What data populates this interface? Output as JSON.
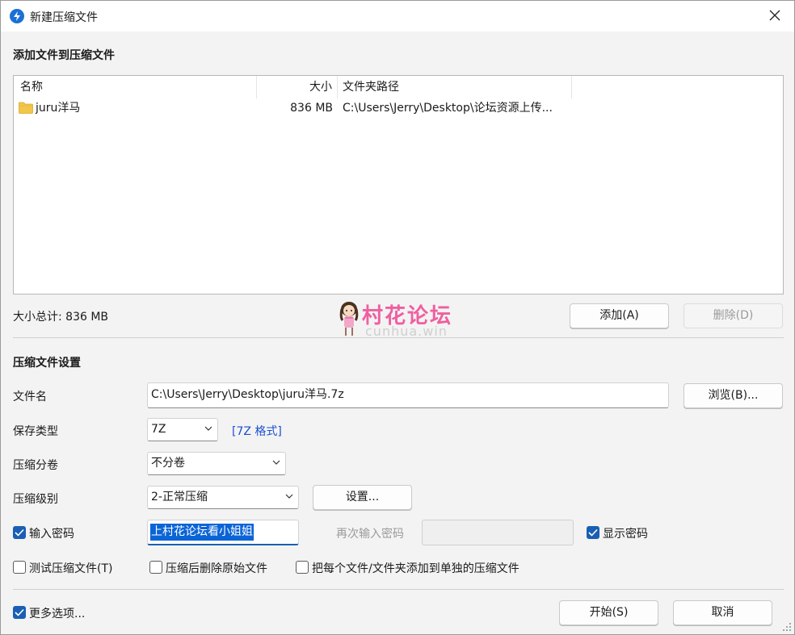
{
  "window": {
    "title": "新建压缩文件"
  },
  "files_section": {
    "title": "添加文件到压缩文件",
    "columns": [
      "名称",
      "大小",
      "文件夹路径"
    ],
    "rows": [
      {
        "name": "juru洋马",
        "size": "836 MB",
        "path": "C:\\Users\\Jerry\\Desktop\\论坛资源上传..."
      }
    ],
    "total_label": "大小总计: 836 MB",
    "add_button": "添加(A)",
    "delete_button": "删除(D)"
  },
  "watermark": {
    "title": "村花论坛",
    "subtitle": "cunhua.win"
  },
  "settings": {
    "title": "压缩文件设置",
    "filename_label": "文件名",
    "filename_value": "C:\\Users\\Jerry\\Desktop\\juru洋马.7z",
    "browse_button": "浏览(B)...",
    "save_type_label": "保存类型",
    "save_type_value": "7Z",
    "format_link": "[7Z 格式]",
    "volume_label": "压缩分卷",
    "volume_value": "不分卷",
    "level_label": "压缩级别",
    "level_value": "2-正常压缩",
    "settings_button": "设置...",
    "password_label": "输入密码",
    "password_checked": true,
    "password_value": "上村花论坛看小姐姐",
    "reenter_label": "再次输入密码",
    "reenter_value": "",
    "show_password_label": "显示密码",
    "show_password_checked": true,
    "test_label": "测试压缩文件(T)",
    "test_checked": false,
    "delete_after_label": "压缩后删除原始文件",
    "delete_after_checked": false,
    "each_separate_label": "把每个文件/文件夹添加到单独的压缩文件",
    "each_separate_checked": false
  },
  "footer": {
    "more_options_label": "更多选项...",
    "more_options_checked": true,
    "start_button": "开始(S)",
    "cancel_button": "取消"
  },
  "colors": {
    "accent": "#1a5fb4",
    "selection": "#0a64d6",
    "link": "#1a4fcf",
    "watermark_pink": "#ef5fa0"
  }
}
